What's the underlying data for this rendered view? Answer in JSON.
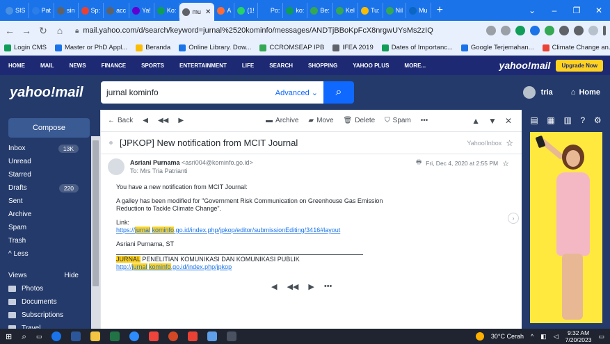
{
  "browser": {
    "tabs": [
      {
        "label": "SIS",
        "color": "#4a90e2"
      },
      {
        "label": "Pat",
        "color": "#2b7de9"
      },
      {
        "label": "sin",
        "color": "#5f6368"
      },
      {
        "label": "Sp:",
        "color": "#e94235"
      },
      {
        "label": "acc",
        "color": "#5f6368"
      },
      {
        "label": "Ya!",
        "color": "#6001d2"
      },
      {
        "label": "Ko:",
        "color": "#0f9d58"
      },
      {
        "label": "mu",
        "color": "#5f6368"
      },
      {
        "label": "A",
        "color": "#ff6b35"
      },
      {
        "label": "(1!",
        "color": "#25d366"
      },
      {
        "label": "Po:",
        "color": "#1a73e8"
      },
      {
        "label": "ko:",
        "color": "#0f9d58"
      },
      {
        "label": "Be:",
        "color": "#34a853"
      },
      {
        "label": "Kel",
        "color": "#34a853"
      },
      {
        "label": "Tu:",
        "color": "#fbbc04"
      },
      {
        "label": "Nil",
        "color": "#34a853"
      },
      {
        "label": "Mu",
        "color": "#0a66c2"
      }
    ],
    "active_tab_label": "",
    "url": "mail.yahoo.com/d/search/keyword=jurnal%2520kominfo/messages/ANDTjBBoKpFcX8nrgwUYsMs2zIQ",
    "bookmarks": [
      {
        "label": "Login CMS",
        "color": "#0f9d58"
      },
      {
        "label": "Master or PhD Appl...",
        "color": "#1a73e8"
      },
      {
        "label": "Beranda",
        "color": "#fbbc04"
      },
      {
        "label": "Online Library. Dow...",
        "color": "#1a73e8"
      },
      {
        "label": "CCROMSEAP IPB",
        "color": "#34a853"
      },
      {
        "label": "IFEA 2019",
        "color": "#5f6368"
      },
      {
        "label": "Dates of Importanc...",
        "color": "#0f9d58"
      },
      {
        "label": "Google Terjemahan...",
        "color": "#1a73e8"
      },
      {
        "label": "Climate Change an...",
        "color": "#ea4335"
      }
    ],
    "bookmarks_more": "»"
  },
  "ynav": {
    "items": [
      "HOME",
      "MAIL",
      "NEWS",
      "FINANCE",
      "SPORTS",
      "ENTERTAINMENT",
      "LIFE",
      "SEARCH",
      "SHOPPING",
      "YAHOO PLUS",
      "MORE..."
    ],
    "brand": "yahoo!mail",
    "upgrade": "Upgrade Now"
  },
  "header": {
    "logo": "yahoo!mail",
    "search_value": "jurnal kominfo",
    "advanced": "Advanced",
    "user_name": "tria",
    "home": "Home"
  },
  "sidebar": {
    "compose": "Compose",
    "items": [
      {
        "label": "Inbox",
        "count": "13K"
      },
      {
        "label": "Unread",
        "count": ""
      },
      {
        "label": "Starred",
        "count": ""
      },
      {
        "label": "Drafts",
        "count": "220"
      },
      {
        "label": "Sent",
        "count": ""
      },
      {
        "label": "Archive",
        "count": ""
      },
      {
        "label": "Spam",
        "count": ""
      },
      {
        "label": "Trash",
        "count": ""
      },
      {
        "label": "^ Less",
        "count": ""
      }
    ],
    "views_label": "Views",
    "views_hide": "Hide",
    "views": [
      {
        "label": "Photos"
      },
      {
        "label": "Documents"
      },
      {
        "label": "Subscriptions"
      },
      {
        "label": "Travel"
      }
    ]
  },
  "toolbar": {
    "back": "Back",
    "archive": "Archive",
    "move": "Move",
    "delete": "Delete",
    "spam": "Spam",
    "more": "•••"
  },
  "message": {
    "subject": "[JPKOP] New notification from MCIT Journal",
    "folder": "Yahoo/Inbox",
    "sender_name": "Asriani Purnama",
    "sender_email": "<asri004@kominfo.go.id>",
    "to": "To: Mrs Tria Patrianti",
    "date": "Fri, Dec 4, 2020 at 2:55 PM",
    "line1": "You have a new notification from MCIT Journal:",
    "line2": "A galley has been modified for \"Government Risk Communication on Greenhouse Gas Emission Reduction to Tackle Climate Change\".",
    "link_label": "Link:",
    "link_pre": "https://",
    "link_hl1": "jurnal",
    "link_hl2": "kominfo",
    "link_post": ".go.id/index.php/jpkop/editor/submissionEditing/3416#layout",
    "signature": "Asriani Purnama, ST",
    "journal_hl": "JURNAL",
    "journal_rest": " PENELITIAN KOMUNIKASI DAN KOMUNIKASI PUBLIK",
    "journal_link_pre": "http://",
    "journal_link_hl1": "jurnal",
    "journal_link_hl2": "kominfo",
    "journal_link_post": ".go.id/index.php/jpkop",
    "more": "•••"
  },
  "taskbar": {
    "weather": "30°C Cerah",
    "time": "9:32 AM",
    "date": "7/20/2023"
  }
}
